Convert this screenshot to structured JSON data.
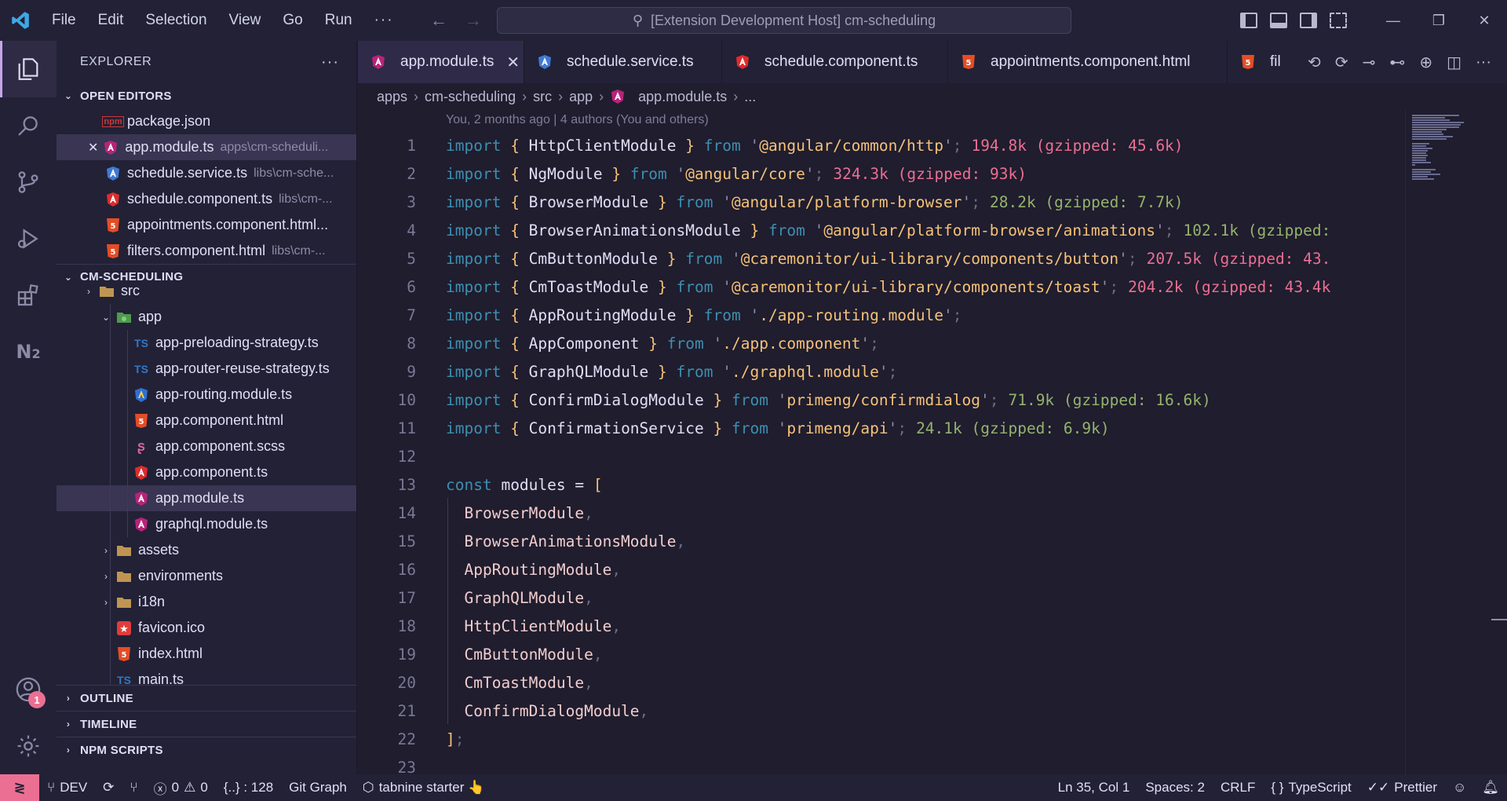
{
  "menu": [
    "File",
    "Edit",
    "Selection",
    "View",
    "Go",
    "Run",
    "···"
  ],
  "command_center": "[Extension Development Host] cm-scheduling",
  "explorer": {
    "title": "EXPLORER",
    "open_editors_label": "OPEN EDITORS",
    "open_editors": [
      {
        "name": "package.json",
        "desc": "",
        "icon": "npm-icon"
      },
      {
        "name": "app.module.ts",
        "desc": "apps\\cm-scheduli...",
        "icon": "angular-module-icon"
      },
      {
        "name": "schedule.service.ts",
        "desc": "libs\\cm-sche...",
        "icon": "angular-service-icon"
      },
      {
        "name": "schedule.component.ts",
        "desc": "libs\\cm-...",
        "icon": "angular-component-icon"
      },
      {
        "name": "appointments.component.html...",
        "desc": "",
        "icon": "html-icon"
      },
      {
        "name": "filters.component.html",
        "desc": "libs\\cm-...",
        "icon": "html-icon"
      }
    ],
    "project_label": "CM-SCHEDULING",
    "tree": [
      {
        "name": "src",
        "indent": 1,
        "type": "folder"
      },
      {
        "name": "app",
        "indent": 2,
        "type": "folder-open"
      },
      {
        "name": "app-preloading-strategy.ts",
        "indent": 3,
        "type": "ts"
      },
      {
        "name": "app-router-reuse-strategy.ts",
        "indent": 3,
        "type": "ts"
      },
      {
        "name": "app-routing.module.ts",
        "indent": 3,
        "type": "routing"
      },
      {
        "name": "app.component.html",
        "indent": 3,
        "type": "html"
      },
      {
        "name": "app.component.scss",
        "indent": 3,
        "type": "scss"
      },
      {
        "name": "app.component.ts",
        "indent": 3,
        "type": "angular"
      },
      {
        "name": "app.module.ts",
        "indent": 3,
        "type": "angular-module"
      },
      {
        "name": "graphql.module.ts",
        "indent": 3,
        "type": "angular-module"
      },
      {
        "name": "assets",
        "indent": 2,
        "type": "folder"
      },
      {
        "name": "environments",
        "indent": 2,
        "type": "folder"
      },
      {
        "name": "i18n",
        "indent": 2,
        "type": "folder"
      },
      {
        "name": "favicon.ico",
        "indent": 2,
        "type": "favicon"
      },
      {
        "name": "index.html",
        "indent": 2,
        "type": "html"
      },
      {
        "name": "main.ts",
        "indent": 2,
        "type": "ts"
      }
    ],
    "outline_label": "OUTLINE",
    "timeline_label": "TIMELINE",
    "npm_label": "NPM SCRIPTS"
  },
  "tabs": [
    {
      "label": "app.module.ts",
      "icon": "angular-module-icon"
    },
    {
      "label": "schedule.service.ts",
      "icon": "angular-service-icon"
    },
    {
      "label": "schedule.component.ts",
      "icon": "angular-component-icon"
    },
    {
      "label": "appointments.component.html",
      "icon": "html-icon"
    },
    {
      "label": "fil",
      "icon": "html-icon"
    }
  ],
  "breadcrumb": [
    "apps",
    "cm-scheduling",
    "src",
    "app",
    "app.module.ts",
    "..."
  ],
  "blame": "You, 2 months ago | 4 authors (You and others)",
  "imports": [
    {
      "name": "HttpClientModule",
      "from": "@angular/common/http",
      "size": "194.8k (gzipped: 45.6k)",
      "heavy": true
    },
    {
      "name": "NgModule",
      "from": "@angular/core",
      "size": "324.3k (gzipped: 93k)",
      "heavy": true
    },
    {
      "name": "BrowserModule",
      "from": "@angular/platform-browser",
      "size": "28.2k (gzipped: 7.7k)",
      "heavy": false
    },
    {
      "name": "BrowserAnimationsModule",
      "from": "@angular/platform-browser/animations",
      "size": "102.1k (gzipped:",
      "heavy": false
    },
    {
      "name": "CmButtonModule",
      "from": "@caremonitor/ui-library/components/button",
      "size": "207.5k (gzipped: 43.",
      "heavy": true
    },
    {
      "name": "CmToastModule",
      "from": "@caremonitor/ui-library/components/toast",
      "size": "204.2k (gzipped: 43.4k",
      "heavy": true
    },
    {
      "name": "AppRoutingModule",
      "from": "./app-routing.module",
      "size": "",
      "heavy": false
    },
    {
      "name": "AppComponent",
      "from": "./app.component",
      "size": "",
      "heavy": false
    },
    {
      "name": "GraphQLModule",
      "from": "./graphql.module",
      "size": "",
      "heavy": false
    },
    {
      "name": "ConfirmDialogModule",
      "from": "primeng/confirmdialog",
      "size": "71.9k (gzipped: 16.6k)",
      "heavy": false
    },
    {
      "name": "ConfirmationService",
      "from": "primeng/api",
      "size": "24.1k (gzipped: 6.9k)",
      "heavy": false
    }
  ],
  "const_line": {
    "kw": "const",
    "name": "modules",
    "op": "=",
    "open": "["
  },
  "modules": [
    "BrowserModule",
    "BrowserAnimationsModule",
    "AppRoutingModule",
    "GraphQLModule",
    "HttpClientModule",
    "CmButtonModule",
    "CmToastModule",
    "ConfirmDialogModule"
  ],
  "close_line": "];",
  "line_numbers": [
    "1",
    "2",
    "3",
    "4",
    "5",
    "6",
    "7",
    "8",
    "9",
    "10",
    "11",
    "12",
    "13",
    "14",
    "15",
    "16",
    "17",
    "18",
    "19",
    "20",
    "21",
    "22",
    "23"
  ],
  "colors": {
    "accent": "#c4a7e7",
    "remote": "#eb6f92",
    "heavy_size": "#eb6f92",
    "light_size": "#95b36c"
  },
  "status": {
    "branch": "DEV",
    "errors": "0",
    "warnings": "0",
    "symbols": "{..} : 128",
    "git_graph": "Git Graph",
    "tabnine": "tabnine starter 👆",
    "position": "Ln 35, Col 1",
    "spaces": "Spaces: 2",
    "eol": "CRLF",
    "language": "TypeScript",
    "prettier": "Prettier"
  },
  "accounts_badge": "1"
}
